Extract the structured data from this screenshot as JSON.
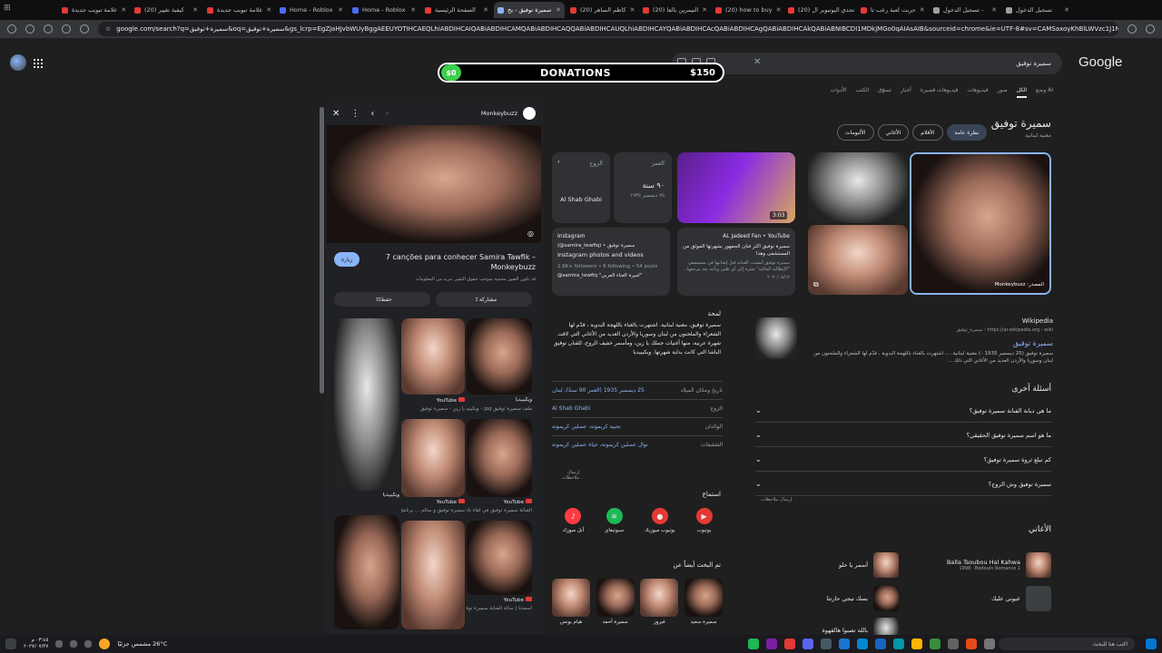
{
  "browser": {
    "tabs": [
      {
        "label": "علامة تبويب جديدة",
        "active": false
      },
      {
        "label": "(20) كيفية تغيير",
        "active": false
      },
      {
        "label": "علامة تبويب جديدة",
        "active": false
      },
      {
        "label": "Home - Roblox",
        "active": false
      },
      {
        "label": "Home - Roblox",
        "active": false
      },
      {
        "label": "الصفحة الرئيسية",
        "active": false
      },
      {
        "label": "سميرة توفيق - بح",
        "active": true
      },
      {
        "label": "(20) كاظم الساهر",
        "active": false
      },
      {
        "label": "(20) التيمرين بالعا",
        "active": false
      },
      {
        "label": "(20) how to buy",
        "active": false
      },
      {
        "label": "(20) تحدي اليوتيوبر ال",
        "active": false
      },
      {
        "label": "جربت لعبة رعب تا",
        "active": false
      },
      {
        "label": "تسجيل الدخول -",
        "active": false
      },
      {
        "label": "تسجيل الدخول",
        "active": false
      }
    ],
    "url": "google.com/search?q=سميرة+توفيق&oq=سميرة+توفيق&gs_lcrp=EgZjaHJvbWUyBggAEEUYOTIHCAEQLhiABDIHCAIQABiABDIHCAMQABiABDIHCAQQABiABDIHCAUQLhiABDIHCAYQABiABDIHCAcQABiABDIHCAgQABiABDIHCAkQABiABNIBCDI1MDkjMGo0qAIAsAIB&sourceid=chrome&ie=UTF-8#sv=CAMSaxoyKhBlLWVzc1J1NjByWTRTazNNMg5lc3N..."
  },
  "google": {
    "logo": "Google",
    "query": "سميرة توفيق",
    "nav_tabs": [
      "وضع AI",
      "الكل",
      "صور",
      "فيديوهات",
      "فيديوهات قصيرة",
      "أخبار",
      "تسوّق",
      "الكتب",
      "الأدوات"
    ],
    "active_nav": "الكل"
  },
  "donations": {
    "left": "$0",
    "title": "DONATIONS",
    "right": "$150"
  },
  "kp": {
    "title": "سميرة توفيق",
    "subtitle": "مغنية لبنانية",
    "chips": [
      "نظرة عامة",
      "الأفلام",
      "الأغاني",
      "الألبومات"
    ],
    "active_chip": "نظرة عامة",
    "main_img_caption": "Monkeybuzz :المصدر",
    "info_card": {
      "label_birth": "العمر",
      "birth_value": "٩٠ سنة",
      "birth_date": "٢٥ ديسمبر ١٩٣٥",
      "label_spouse": "الزوج",
      "spouse_value": "Al Shab Ghabi"
    },
    "youtube_card": {
      "source": "AL Jadeed Fan • YouTube",
      "text": "سميرة توفيق اكثر فنان الجمهور بشهرتها الموثق من المستشفى وهذا",
      "text2": "سميرة توفيق أنشدت الفنانة قبل إصابتها في مستشفى \"الإيطالية الخالية\" نشرة إلى أي طبي ويأتيه بعد مرجعها...",
      "date": "٢٠٢٠/٠٨/١٢",
      "duration": "3:03"
    },
    "instagram_card": {
      "source": "Instagram",
      "handle": "(@samira_tewfiq) • سميرة توفيق",
      "title": "Instagram photos and videos",
      "stats": "2.6K+ followers • 6 following • 54 posts",
      "desc": "@samira_tewfiq \"اميرة الغناء العربي\""
    },
    "wiki": {
      "source": "Wikipedia",
      "url": "https://ar.wikipedia.org › wiki › سميرة_توفيق",
      "title": "سميرة توفيق",
      "desc": "سميرة توفيق (25 ديسمبر 1935 –) مغنية لبنانية. ... اشتهرت بالغناء باللهجة البدوية ، قدّم لها الشعراء والملحنون من لبنان وسوريا والأردن العديد من الأغاني التي ذلك ..."
    },
    "about_title": "لمحة",
    "about_text": "سميرة توفيق، مغنية لبنانية. اشتهرت بالغناء باللهجة البدوية ، قدّم لها الشعراء والملحنون من لبنان وسوريا والأردن العديد من الأغاني التي لاقت شهرة عربية، منها أغنيات جملك يا زين، ومأسمر خفيف الروح، للفنان توفيق الباشا التي كانت بداية شهرتها. ويكيبيديا",
    "facts": [
      {
        "k": "تاريخ ومكان الميلاد",
        "v": "25 ديسمبر 1935 (العمر 90 سنةً)، لبنان"
      },
      {
        "k": "الزوج",
        "v": "Al Shab Ghabi"
      },
      {
        "k": "الوالدان",
        "v": "نجيبة كريمونة، عصلين كريمونة"
      },
      {
        "k": "الشقيقات",
        "v": "نوال عصلين كريمونة، حياة عصلين كريمونة"
      }
    ],
    "feedback": "إرسال ملاحظات",
    "listen_title": "استماع",
    "listen_buttons": [
      "يوتيوب",
      "يوتيوب ميوزيك",
      "سبوتيفاي",
      "أبل ميوزك"
    ],
    "also_title": "تم البحث أيضاً عن",
    "also": [
      "سميرة سعيد",
      "فيروز",
      "سميرة أحمد",
      "هيام يونس"
    ],
    "paa_title": "أسئلة أخرى",
    "paa": [
      "ما هي ديانة الفنانة سميرة توفيق؟",
      "ما هو اسم سميرة توفيق الحقيقي؟",
      "كم تبلغ ثروة سميرة توفيق؟",
      "سميرة توفيق وش الزوج؟"
    ],
    "songs_title": "الأغاني",
    "songs": [
      {
        "title": "Balla Tsoubou Hal Kahwa",
        "meta": "1998 · Bedouin Romance 1",
        "side_title": "أسمر يا حلو"
      },
      {
        "title": "عيوني عليك",
        "meta": "",
        "side_title": "بسك تيجي حارتنا"
      },
      {
        "title": "",
        "meta": "",
        "side_title": "بالله تصبوا هالقهوة"
      }
    ]
  },
  "panel": {
    "source": "Monkeybuzz",
    "title": "7 canções para conhecer Samira Tawfik – Monkeybuzz",
    "visit": "زيارة",
    "note": "قد تكون الصور محمية بموجب حقوق النشر. مزيد من المعلومات",
    "share": "مشاركة",
    "save": "حفظ",
    "grid": [
      {
        "caption": "ويكيبيديا",
        "sub": "ملف:سميرة توفيق jpg - ويكيبيديا"
      },
      {
        "caption": "YouTube",
        "sub": "يا زين - سميرة توفيق"
      },
      {
        "caption": "ويكيبيديا",
        "sub": ""
      },
      {
        "caption": "YouTube",
        "sub": "الفنانة سميرة توفيق في لقاء نادر"
      },
      {
        "caption": "YouTube",
        "sub": "سميرة توفيق و سالم ... برنامج"
      },
      {
        "caption": "YouTube",
        "sub": "أسعدنا | سالة الفنانة سميرة توفيق"
      }
    ]
  },
  "taskbar": {
    "search": "اكتب هنا للبحث",
    "weather": "26°C مشمس جزئيًا",
    "time": "٠٣:٤٥ م",
    "date": "٢٠٢٧/٠٧/٢٧"
  }
}
